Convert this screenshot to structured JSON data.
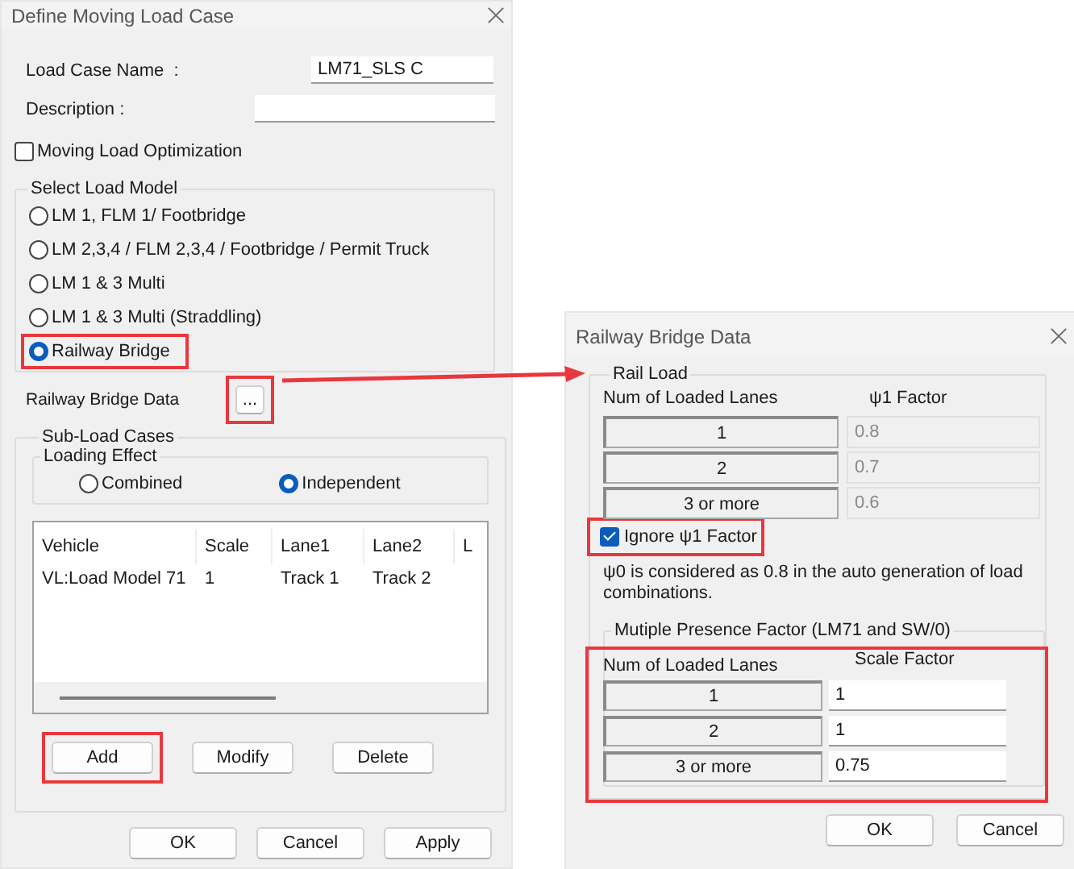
{
  "main_dialog": {
    "title": "Define Moving Load Case",
    "load_case_name": {
      "label": "Load Case Name  :",
      "value": "LM71_SLS C"
    },
    "description": {
      "label": "Description :"
    },
    "optimization": {
      "label": "Moving Load Optimization",
      "checked": false
    },
    "load_model": {
      "title": "Select Load Model",
      "options": [
        {
          "label": "LM 1, FLM 1/ Footbridge",
          "selected": false,
          "highlighted": false
        },
        {
          "label": "LM 2,3,4 / FLM 2,3,4 / Footbridge / Permit Truck",
          "selected": false,
          "highlighted": false
        },
        {
          "label": "LM 1 & 3 Multi",
          "selected": false,
          "highlighted": false
        },
        {
          "label": "LM 1 & 3 Multi (Straddling)",
          "selected": false,
          "highlighted": false
        },
        {
          "label": "Railway Bridge",
          "selected": true,
          "highlighted": true
        }
      ]
    },
    "railway_bridge_data": {
      "label": "Railway Bridge Data",
      "button": "...",
      "highlighted": true
    },
    "sub_load_cases": {
      "title": "Sub-Load Cases",
      "loading_effect": {
        "title": "Loading Effect",
        "options": [
          {
            "label": "Combined",
            "selected": false
          },
          {
            "label": "Independent",
            "selected": true
          }
        ]
      },
      "table": {
        "columns": [
          "Vehicle",
          "Scale",
          "Lane1",
          "Lane2",
          "L"
        ],
        "rows": [
          [
            "VL:Load Model 71",
            "1",
            "Track 1",
            "Track 2"
          ]
        ]
      },
      "buttons": [
        {
          "label": "Add",
          "highlighted": true
        },
        {
          "label": "Modify",
          "highlighted": false
        },
        {
          "label": "Delete",
          "highlighted": false
        }
      ]
    },
    "buttons": [
      "OK",
      "Cancel",
      "Apply"
    ]
  },
  "railway_dialog": {
    "title": "Railway Bridge Data",
    "rail_load": {
      "title": "Rail Load",
      "columns": [
        "Num of Loaded Lanes",
        "ψ1 Factor"
      ],
      "factor_disabled": true,
      "rows": [
        {
          "lanes": "1",
          "factor": "0.8"
        },
        {
          "lanes": "2",
          "factor": "0.7"
        },
        {
          "lanes": "3 or more",
          "factor": "0.6"
        }
      ]
    },
    "ignore_factor": {
      "label": "Ignore ψ1 Factor",
      "checked": true,
      "highlighted": true
    },
    "note": "ψ0 is considered as 0.8 in the auto generation of load combinations.",
    "presence": {
      "title": "Mutiple Presence Factor (LM71 and SW/0)",
      "highlighted": true,
      "columns": [
        "Num of Loaded Lanes",
        "Scale Factor"
      ],
      "rows": [
        {
          "lanes": "1",
          "factor": "1"
        },
        {
          "lanes": "2",
          "factor": "1"
        },
        {
          "lanes": "3 or more",
          "factor": "0.75"
        }
      ]
    },
    "buttons": [
      "OK",
      "Cancel"
    ]
  }
}
